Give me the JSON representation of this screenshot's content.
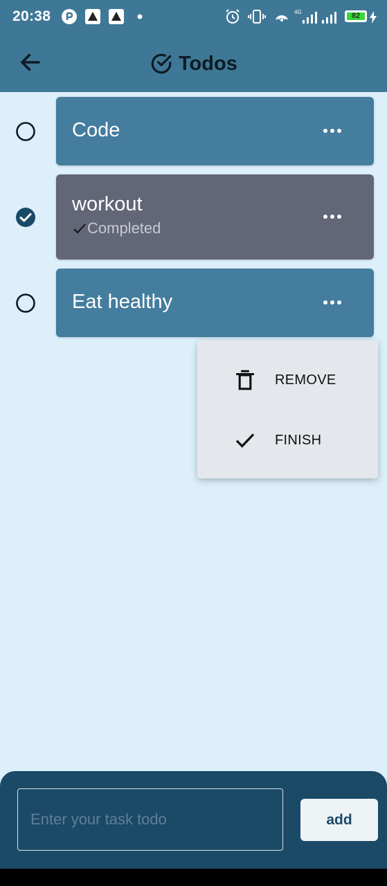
{
  "status_bar": {
    "time": "20:38",
    "battery": "82",
    "network": "4G",
    "icons": [
      "notification-icon",
      "app-icon",
      "app-icon",
      "dot-icon",
      "alarm-icon",
      "vibrate-icon",
      "hotspot-icon",
      "signal-icon",
      "battery-icon",
      "charging-icon"
    ]
  },
  "app_bar": {
    "title": "Todos",
    "back_icon": "arrow-left-icon",
    "title_icon": "check-circle-icon",
    "color": "#3f7896"
  },
  "todos": [
    {
      "title": "Code",
      "completed": false
    },
    {
      "title": "workout",
      "completed": true,
      "status": "Completed"
    },
    {
      "title": "Eat healthy",
      "completed": false
    }
  ],
  "context_menu": {
    "items": [
      {
        "label": "REMOVE",
        "icon": "trash-icon"
      },
      {
        "label": "FINISH",
        "icon": "check-icon"
      }
    ]
  },
  "input": {
    "placeholder": "Enter your task todo",
    "value": ""
  },
  "add_button": {
    "label": "add"
  },
  "colors": {
    "background": "#dceffb",
    "card": "#447d9e",
    "card_done": "#626676",
    "panel": "#1b4a67"
  }
}
